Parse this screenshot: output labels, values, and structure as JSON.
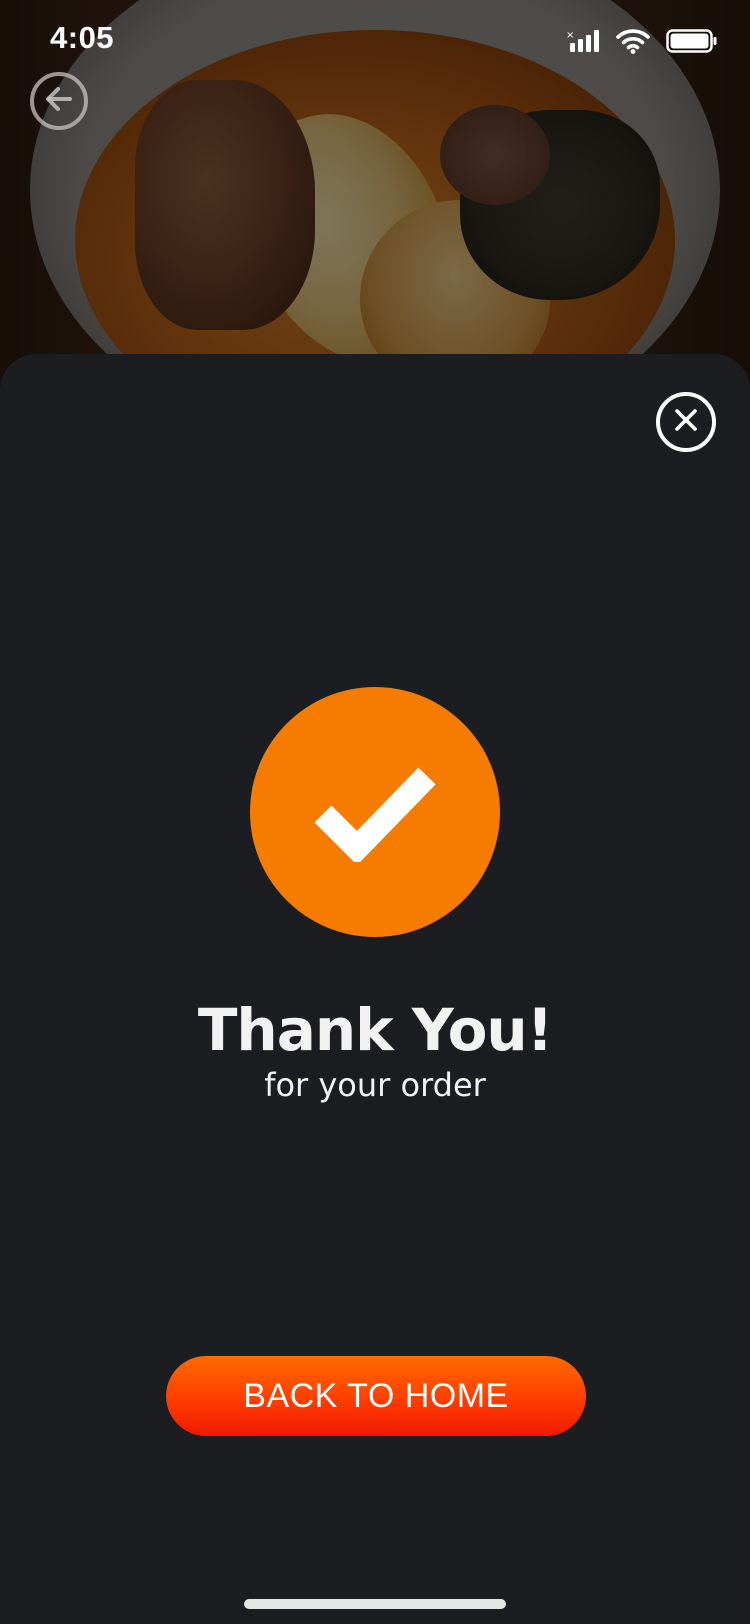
{
  "status_bar": {
    "time": "4:05",
    "icons": [
      "cellular-signal-icon",
      "wifi-icon",
      "battery-icon"
    ]
  },
  "header": {
    "back_icon": "arrow-left-circle-icon"
  },
  "sheet": {
    "close_icon": "close-circle-icon",
    "success_icon": "checkmark-icon",
    "title": "Thank You!",
    "subtitle": "for your order",
    "button_label": "BACK TO HOME"
  },
  "colors": {
    "accent": "#f57c00",
    "button_top": "#ff6a00",
    "button_bottom": "#f01800",
    "sheet_background": "#1b1d20",
    "text": "#f2f2f2"
  }
}
